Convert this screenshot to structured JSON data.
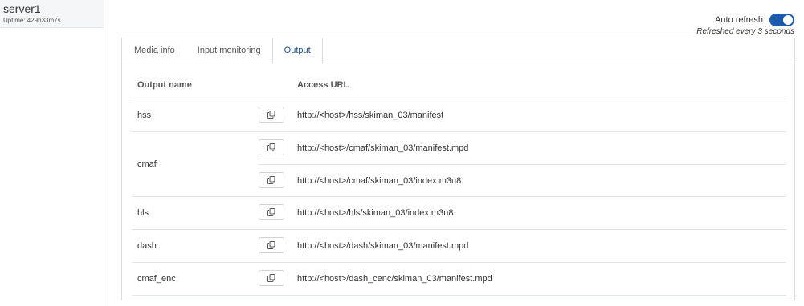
{
  "sidebar": {
    "server_name": "server1",
    "uptime": "Uptime: 429h33m7s"
  },
  "refresh": {
    "label": "Auto refresh",
    "enabled": true,
    "note": "Refreshed every 3 seconds",
    "accent_color": "#1b5cae"
  },
  "tabs": [
    {
      "label": "Media info",
      "active": false
    },
    {
      "label": "Input monitoring",
      "active": false
    },
    {
      "label": "Output",
      "active": true
    }
  ],
  "table": {
    "headers": {
      "name": "Output name",
      "url": "Access URL"
    },
    "rows": [
      {
        "name": "hss",
        "urls": [
          "http://<host>/hss/skiman_03/manifest"
        ]
      },
      {
        "name": "cmaf",
        "urls": [
          "http://<host>/cmaf/skiman_03/manifest.mpd",
          "http://<host>/cmaf/skiman_03/index.m3u8"
        ]
      },
      {
        "name": "hls",
        "urls": [
          "http://<host>/hls/skiman_03/index.m3u8"
        ]
      },
      {
        "name": "dash",
        "urls": [
          "http://<host>/dash/skiman_03/manifest.mpd"
        ]
      },
      {
        "name": "cmaf_enc",
        "urls": [
          "http://<host>/dash_cenc/skiman_03/manifest.mpd"
        ]
      }
    ]
  }
}
